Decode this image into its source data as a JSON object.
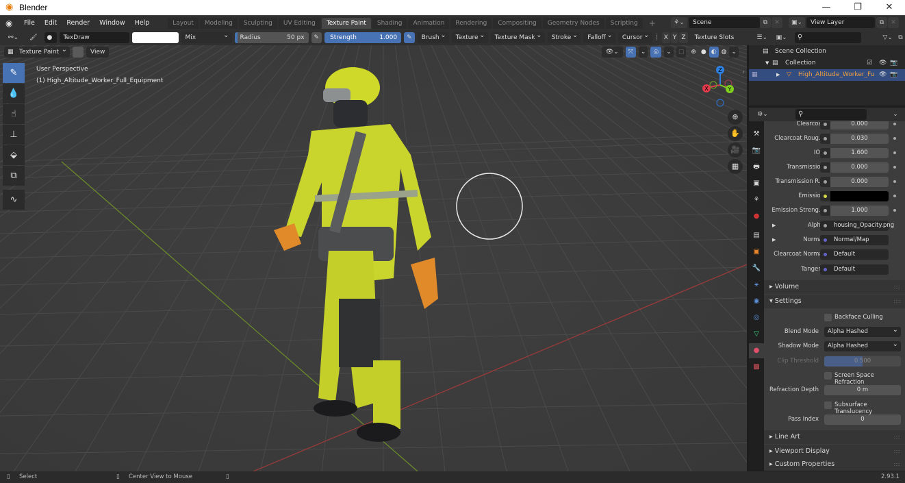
{
  "window": {
    "title": "Blender",
    "minimize": "—",
    "restore": "❐",
    "close": "✕"
  },
  "menu": {
    "items": [
      "File",
      "Edit",
      "Render",
      "Window",
      "Help"
    ]
  },
  "workspaces": {
    "tabs": [
      "Layout",
      "Modeling",
      "Sculpting",
      "UV Editing",
      "Texture Paint",
      "Shading",
      "Animation",
      "Rendering",
      "Compositing",
      "Geometry Nodes",
      "Scripting"
    ],
    "active": "Texture Paint",
    "add": "+"
  },
  "scene": {
    "label": "Scene",
    "view_layer": "View Layer"
  },
  "tool_header": {
    "brush_name": "TexDraw",
    "color": "#ffffff",
    "blend": "Mix",
    "radius_label": "Radius",
    "radius_value": "50 px",
    "strength_label": "Strength",
    "strength_value": "1.000",
    "menus": [
      "Brush",
      "Texture",
      "Texture Mask",
      "Stroke",
      "Falloff",
      "Cursor"
    ],
    "axes": [
      "X",
      "Y",
      "Z"
    ],
    "texture_slots": "Texture Slots"
  },
  "viewport_header": {
    "mode": "Texture Paint",
    "view": "View"
  },
  "viewport": {
    "perspective": "User Perspective",
    "object": "(1) High_Altitude_Worker_Full_Equipment",
    "gizmo": {
      "x": "X",
      "y": "Y",
      "z": "Z"
    }
  },
  "outliner": {
    "scene_collection": "Scene Collection",
    "collection": "Collection",
    "object": "High_Altitude_Worker_Fu"
  },
  "properties": {
    "rows": [
      {
        "label": "Clearcoat",
        "value": "0.000"
      },
      {
        "label": "Clearcoat Roug...",
        "value": "0.030"
      },
      {
        "label": "IOR",
        "value": "1.600"
      },
      {
        "label": "Transmission",
        "value": "0.000"
      },
      {
        "label": "Transmission R...",
        "value": "0.000"
      },
      {
        "label": "Emission",
        "value": ""
      },
      {
        "label": "Emission Streng...",
        "value": "1.000"
      },
      {
        "label": "Alpha",
        "value": "housing_Opacity.png"
      },
      {
        "label": "Normal",
        "value": "Normal/Map"
      },
      {
        "label": "Clearcoat Normal",
        "value": "Default"
      },
      {
        "label": "Tangent",
        "value": "Default"
      }
    ],
    "volume": "Volume",
    "settings": {
      "title": "Settings",
      "backface_culling": "Backface Culling",
      "blend_mode_label": "Blend Mode",
      "blend_mode": "Alpha Hashed",
      "shadow_mode_label": "Shadow Mode",
      "shadow_mode": "Alpha Hashed",
      "clip_threshold_label": "Clip Threshold",
      "clip_threshold": "0.500",
      "ssr": "Screen Space Refraction",
      "refraction_depth_label": "Refraction Depth",
      "refraction_depth": "0 m",
      "subsurface": "Subsurface Translucency",
      "pass_index_label": "Pass Index",
      "pass_index": "0"
    },
    "line_art": "Line Art",
    "viewport_display": "Viewport Display",
    "custom_properties": "Custom Properties"
  },
  "statusbar": {
    "select": "Select",
    "center": "Center View to Mouse",
    "version": "2.93.1"
  }
}
